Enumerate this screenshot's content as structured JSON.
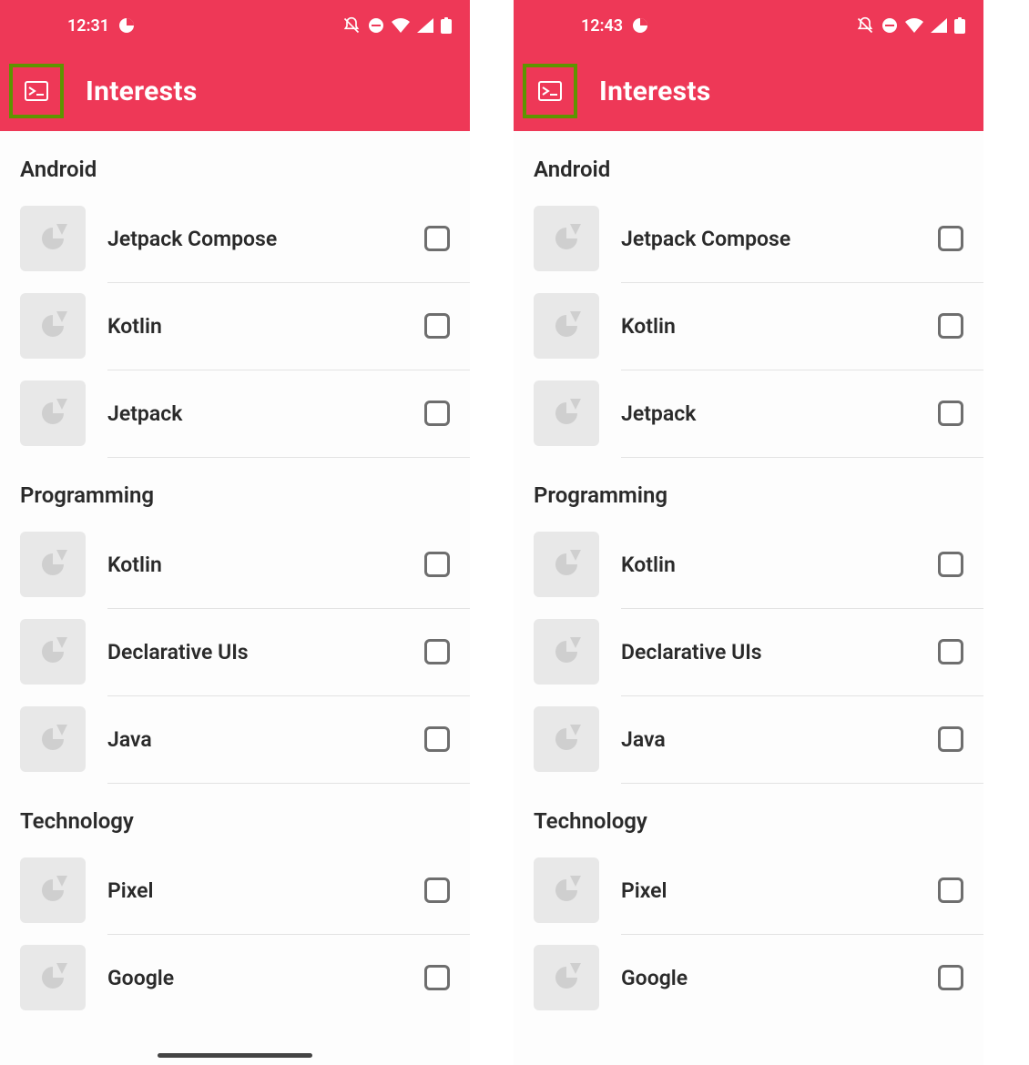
{
  "phones": [
    {
      "status": {
        "time": "12:31"
      },
      "appbar": {
        "title": "Interests"
      },
      "sections": [
        {
          "title": "Android",
          "items": [
            "Jetpack Compose",
            "Kotlin",
            "Jetpack"
          ]
        },
        {
          "title": "Programming",
          "items": [
            "Kotlin",
            "Declarative UIs",
            "Java"
          ]
        },
        {
          "title": "Technology",
          "items": [
            "Pixel",
            "Google"
          ]
        }
      ]
    },
    {
      "status": {
        "time": "12:43"
      },
      "appbar": {
        "title": "Interests"
      },
      "sections": [
        {
          "title": "Android",
          "items": [
            "Jetpack Compose",
            "Kotlin",
            "Jetpack"
          ]
        },
        {
          "title": "Programming",
          "items": [
            "Kotlin",
            "Declarative UIs",
            "Java"
          ]
        },
        {
          "title": "Technology",
          "items": [
            "Pixel",
            "Google"
          ]
        }
      ]
    }
  ]
}
